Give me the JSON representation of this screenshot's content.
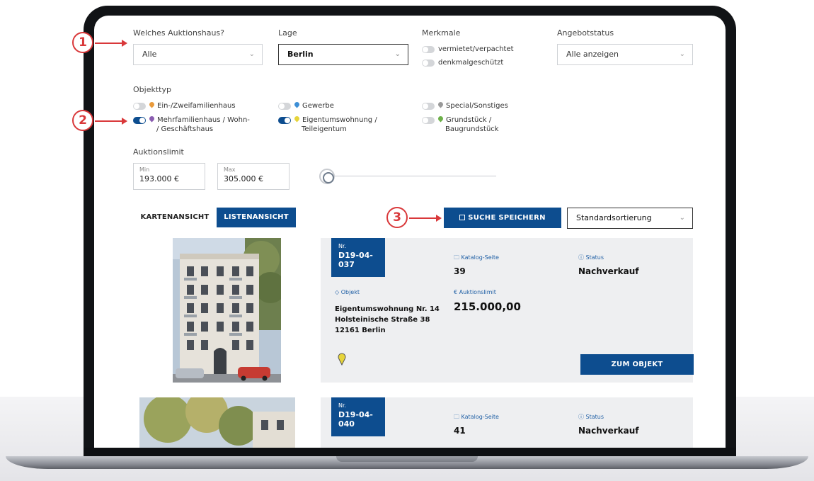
{
  "filters": {
    "auktionshaus": {
      "label": "Welches Auktionshaus?",
      "value": "Alle"
    },
    "lage": {
      "label": "Lage",
      "value": "Berlin"
    },
    "merkmale": {
      "label": "Merkmale",
      "options": [
        {
          "label": "vermietet/verpachtet",
          "checked": false
        },
        {
          "label": "denkmalgeschützt",
          "checked": false
        }
      ]
    },
    "angebotstatus": {
      "label": "Angebotstatus",
      "value": "Alle anzeigen"
    },
    "objekttyp": {
      "label": "Objekttyp",
      "options": [
        {
          "label": "Ein-/Zweifamilienhaus",
          "checked": false,
          "pin_color": "#e99a3b"
        },
        {
          "label_line1": "Mehrfamilienhaus / Wohn-",
          "label_line2": "/ Geschäftshaus",
          "checked": true,
          "pin_color": "#8a5db0"
        },
        {
          "label": "Gewerbe",
          "checked": false,
          "pin_color": "#3d8fd6"
        },
        {
          "label_line1": "Eigentumswohnung /",
          "label_line2": "Teileigentum",
          "checked": true,
          "pin_color": "#e6d43a"
        },
        {
          "label": "Special/Sonstiges",
          "checked": false,
          "pin_color": "#9a9a9a"
        },
        {
          "label_line1": "Grundstück /",
          "label_line2": "Baugrundstück",
          "checked": false,
          "pin_color": "#6db04a"
        }
      ]
    },
    "auktionslimit": {
      "label": "Auktionslimit",
      "min_label": "Min",
      "min_value": "193.000 €",
      "max_label": "Max",
      "max_value": "305.000 €"
    }
  },
  "views": {
    "karten": "KARTENANSICHT",
    "liste": "LISTENANSICHT",
    "active": "liste"
  },
  "save_search": {
    "icon": "save-icon",
    "label": "SUCHE SPEICHERN"
  },
  "sort": {
    "value": "Standardsortierung"
  },
  "listings": [
    {
      "nr_label": "Nr.",
      "nr": "D19-04-037",
      "katalog_label": "Katalog-Seite",
      "katalog": "39",
      "status_label": "Status",
      "status": "Nachverkauf",
      "objekt_label": "Objekt",
      "objekt_line1": "Eigentumswohnung Nr. 14",
      "objekt_line2": "Holsteinische Straße 38",
      "objekt_line3": "12161 Berlin",
      "limit_label": "€ Auktionslimit",
      "limit": "215.000,00",
      "cta": "ZUM OBJEKT",
      "pin_color": "#e6d43a"
    },
    {
      "nr_label": "Nr.",
      "nr": "D19-04-040",
      "katalog_label": "Katalog-Seite",
      "katalog": "41",
      "status_label": "Status",
      "status": "Nachverkauf"
    }
  ],
  "annotations": [
    "1",
    "2",
    "3"
  ],
  "colors": {
    "brand_blue": "#0d4d8f",
    "annotation_red": "#d9383a"
  }
}
